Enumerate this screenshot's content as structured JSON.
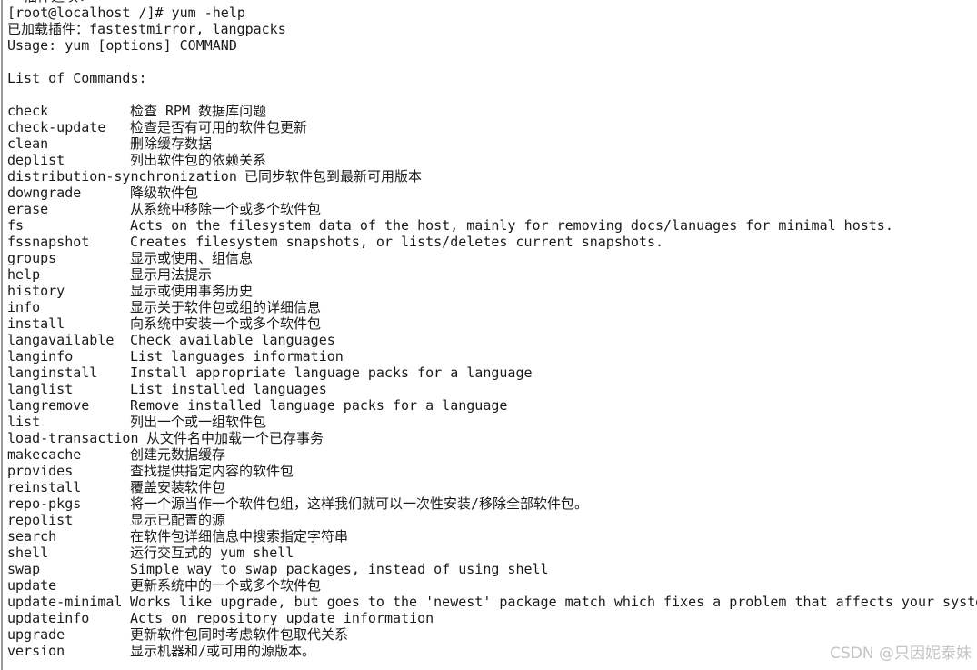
{
  "terminal": {
    "lines_top": [
      "  插件选项:",
      "[root@localhost /]# yum -help",
      "已加载插件：fastestmirror, langpacks",
      "Usage: yum [options] COMMAND",
      "",
      "List of Commands:",
      ""
    ],
    "commands": [
      {
        "cmd": "check",
        "desc": "检查 RPM 数据库问题"
      },
      {
        "cmd": "check-update",
        "desc": "检查是否有可用的软件包更新"
      },
      {
        "cmd": "clean",
        "desc": "删除缓存数据"
      },
      {
        "cmd": "deplist",
        "desc": "列出软件包的依赖关系"
      },
      {
        "cmd": "distribution-synchronization",
        "desc": "已同步软件包到最新可用版本",
        "inline": true
      },
      {
        "cmd": "downgrade",
        "desc": "降级软件包"
      },
      {
        "cmd": "erase",
        "desc": "从系统中移除一个或多个软件包"
      },
      {
        "cmd": "fs",
        "desc": "Acts on the filesystem data of the host, mainly for removing docs/lanuages for minimal hosts."
      },
      {
        "cmd": "fssnapshot",
        "desc": "Creates filesystem snapshots, or lists/deletes current snapshots."
      },
      {
        "cmd": "groups",
        "desc": "显示或使用、组信息"
      },
      {
        "cmd": "help",
        "desc": "显示用法提示"
      },
      {
        "cmd": "history",
        "desc": "显示或使用事务历史"
      },
      {
        "cmd": "info",
        "desc": "显示关于软件包或组的详细信息"
      },
      {
        "cmd": "install",
        "desc": "向系统中安装一个或多个软件包"
      },
      {
        "cmd": "langavailable",
        "desc": "Check available languages"
      },
      {
        "cmd": "langinfo",
        "desc": "List languages information"
      },
      {
        "cmd": "langinstall",
        "desc": "Install appropriate language packs for a language"
      },
      {
        "cmd": "langlist",
        "desc": "List installed languages"
      },
      {
        "cmd": "langremove",
        "desc": "Remove installed language packs for a language"
      },
      {
        "cmd": "list",
        "desc": "列出一个或一组软件包"
      },
      {
        "cmd": "load-transaction",
        "desc": "从文件名中加载一个已存事务",
        "inline": true
      },
      {
        "cmd": "makecache",
        "desc": "创建元数据缓存"
      },
      {
        "cmd": "provides",
        "desc": "查找提供指定内容的软件包"
      },
      {
        "cmd": "reinstall",
        "desc": "覆盖安装软件包"
      },
      {
        "cmd": "repo-pkgs",
        "desc": "将一个源当作一个软件包组，这样我们就可以一次性安装/移除全部软件包。"
      },
      {
        "cmd": "repolist",
        "desc": "显示已配置的源"
      },
      {
        "cmd": "search",
        "desc": "在软件包详细信息中搜索指定字符串"
      },
      {
        "cmd": "shell",
        "desc": "运行交互式的 yum shell"
      },
      {
        "cmd": "swap",
        "desc": "Simple way to swap packages, instead of using shell"
      },
      {
        "cmd": "update",
        "desc": "更新系统中的一个或多个软件包"
      },
      {
        "cmd": "update-minimal",
        "desc": "Works like upgrade, but goes to the 'newest' package match which fixes a problem that affects your system"
      },
      {
        "cmd": "updateinfo",
        "desc": "Acts on repository update information"
      },
      {
        "cmd": "upgrade",
        "desc": "更新软件包同时考虑软件包取代关系"
      },
      {
        "cmd": "version",
        "desc": "显示机器和/或可用的源版本。"
      }
    ]
  },
  "watermark": "CSDN @只因妮泰妹"
}
